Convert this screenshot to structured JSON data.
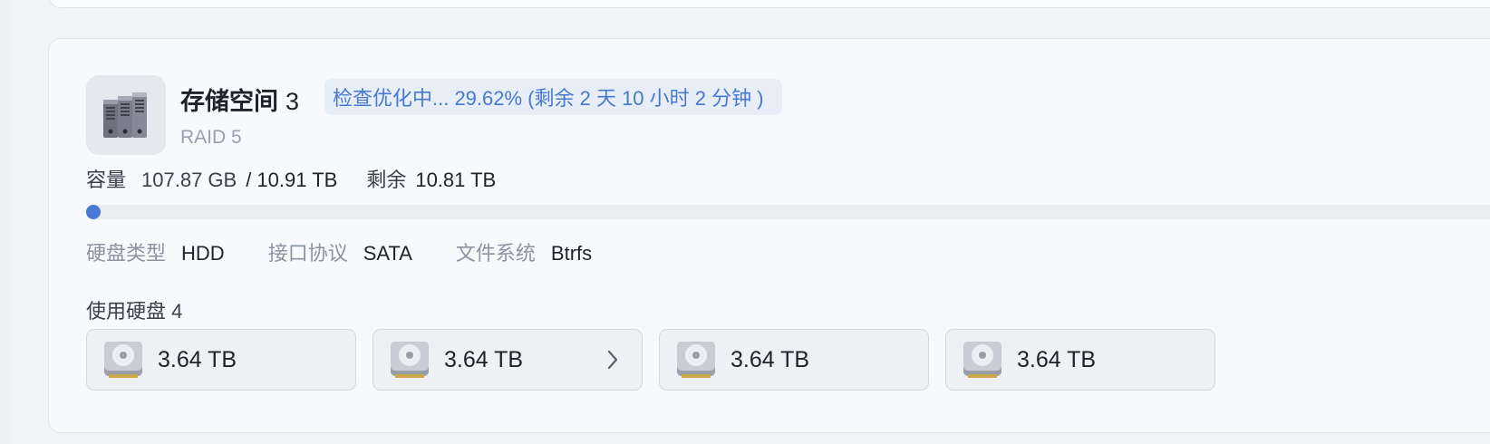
{
  "storage": {
    "title": "存储空间",
    "count": "3",
    "status": "检查优化中... 29.62% (剩余 2 天 10 小时 2 分钟 )",
    "raid": "RAID 5",
    "icon": "server-icon"
  },
  "capacity": {
    "label": "容量",
    "used": "107.87 GB",
    "total": "/ 10.91 TB",
    "remain_label": "剩余",
    "remain": "10.81 TB",
    "used_fraction": 0.0097,
    "bar_color": "#4a78d6"
  },
  "specs": [
    {
      "label": "硬盘类型",
      "value": "HDD"
    },
    {
      "label": "接口协议",
      "value": "SATA"
    },
    {
      "label": "文件系统",
      "value": "Btrfs"
    }
  ],
  "disks": {
    "label": "使用硬盘 4",
    "items": [
      {
        "size": "3.64 TB",
        "icon": "hard-disk-icon"
      },
      {
        "size": "3.64 TB",
        "icon": "hard-disk-icon",
        "chevron": "chevron-right-icon"
      },
      {
        "size": "3.64 TB",
        "icon": "hard-disk-icon"
      },
      {
        "size": "3.64 TB",
        "icon": "hard-disk-icon"
      }
    ]
  }
}
